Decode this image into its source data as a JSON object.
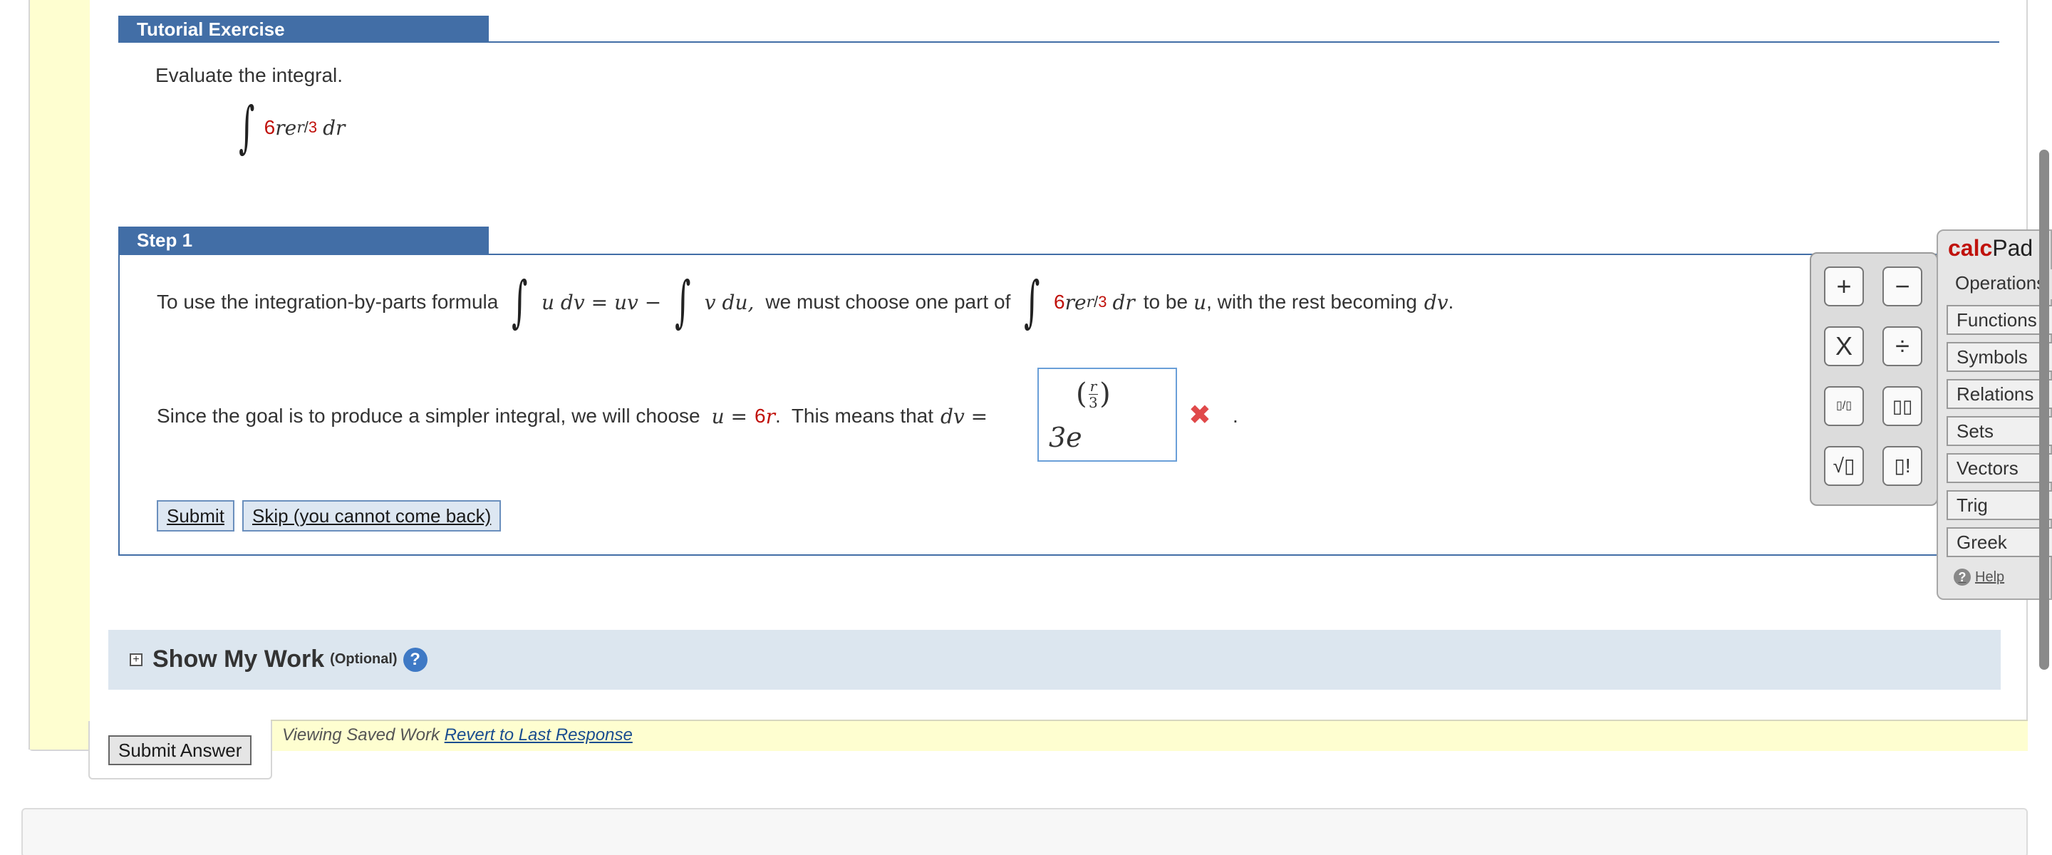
{
  "tutorial": {
    "header": "Tutorial Exercise",
    "instruction": "Evaluate the integral.",
    "integrand": {
      "coef": "6",
      "var": "r",
      "base": "e",
      "exp_var": "r",
      "exp_div": "/",
      "exp_num": "3",
      "differential": "dr"
    }
  },
  "step": {
    "header": "Step 1",
    "line1": {
      "before": "To use the integration-by-parts formula",
      "formula_left": "u dv = uv −",
      "formula_right": "v du,",
      "middle": "we must choose one part of",
      "after": "to be",
      "u": "u",
      "after2": ", with the rest becoming",
      "dv": "dv",
      "period": "."
    },
    "line2": {
      "before": "Since the goal is to produce a simpler integral, we will choose",
      "u_eq": "u =",
      "six": "6",
      "r": "r",
      "mid": ".  This means that",
      "dv_eq": "dv ="
    },
    "answer": {
      "base": "3e",
      "exp_num": "r",
      "exp_den": "3",
      "status": "incorrect"
    },
    "trailing_dot": ".",
    "buttons": {
      "submit": "Submit",
      "skip": "Skip (you cannot come back)"
    }
  },
  "keypad": {
    "keys": [
      "+",
      "−",
      "X",
      "÷",
      "▯/▯",
      "▯▯",
      "√▯",
      "▯!"
    ]
  },
  "calcpad": {
    "title_calc": "calc",
    "title_pad": "Pad",
    "tabs": [
      "Operations",
      "Functions",
      "Symbols",
      "Relations",
      "Sets",
      "Vectors",
      "Trig",
      "Greek"
    ],
    "help": "Help"
  },
  "show_my_work": {
    "title": "Show My Work",
    "optional": "(Optional)",
    "help_icon": "?"
  },
  "footer": {
    "submit_answer": "Submit Answer",
    "status_text": "Viewing Saved Work",
    "revert_link": "Revert to Last Response"
  },
  "colors": {
    "header_blue": "#426ea6",
    "highlight_red": "#c0120c",
    "status_yellow": "#fefed0"
  }
}
